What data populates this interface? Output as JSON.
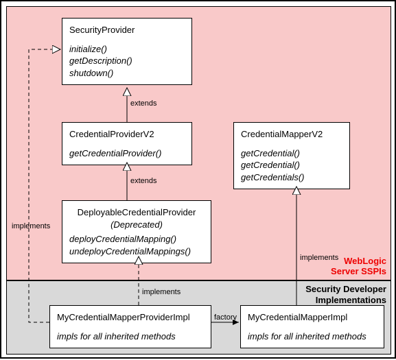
{
  "regions": {
    "top_label_line1": "WebLogic",
    "top_label_line2": "Server SSPIs",
    "bottom_label_line1": "Security Developer",
    "bottom_label_line2": "Implementations"
  },
  "nodes": {
    "securityProvider": {
      "title": "SecurityProvider",
      "m1": "initialize()",
      "m2": "getDescription()",
      "m3": "shutdown()"
    },
    "credentialProviderV2": {
      "title": "CredentialProviderV2",
      "m1": "getCredentialProvider()"
    },
    "deployableCredentialProvider": {
      "title": "DeployableCredentialProvider",
      "subtitle": "(Deprecated)",
      "m1": "deployCredentialMapping()",
      "m2": "undeployCredentialMappings()"
    },
    "credentialMapperV2": {
      "title": "CredentialMapperV2",
      "m1": "getCredential()",
      "m2": "getCredential()",
      "m3": "getCredentials()"
    },
    "myCredentialMapperProviderImpl": {
      "title": "MyCredentialMapperProviderImpl",
      "sub": "impls for all inherited methods"
    },
    "myCredentialMapperImpl": {
      "title": "MyCredentialMapperImpl",
      "sub": "impls for all inherited methods"
    }
  },
  "edges": {
    "extends1": "extends",
    "extends2": "extends",
    "implements1": "implements",
    "implements2": "implements",
    "implements3": "implements",
    "factory": "factory"
  }
}
